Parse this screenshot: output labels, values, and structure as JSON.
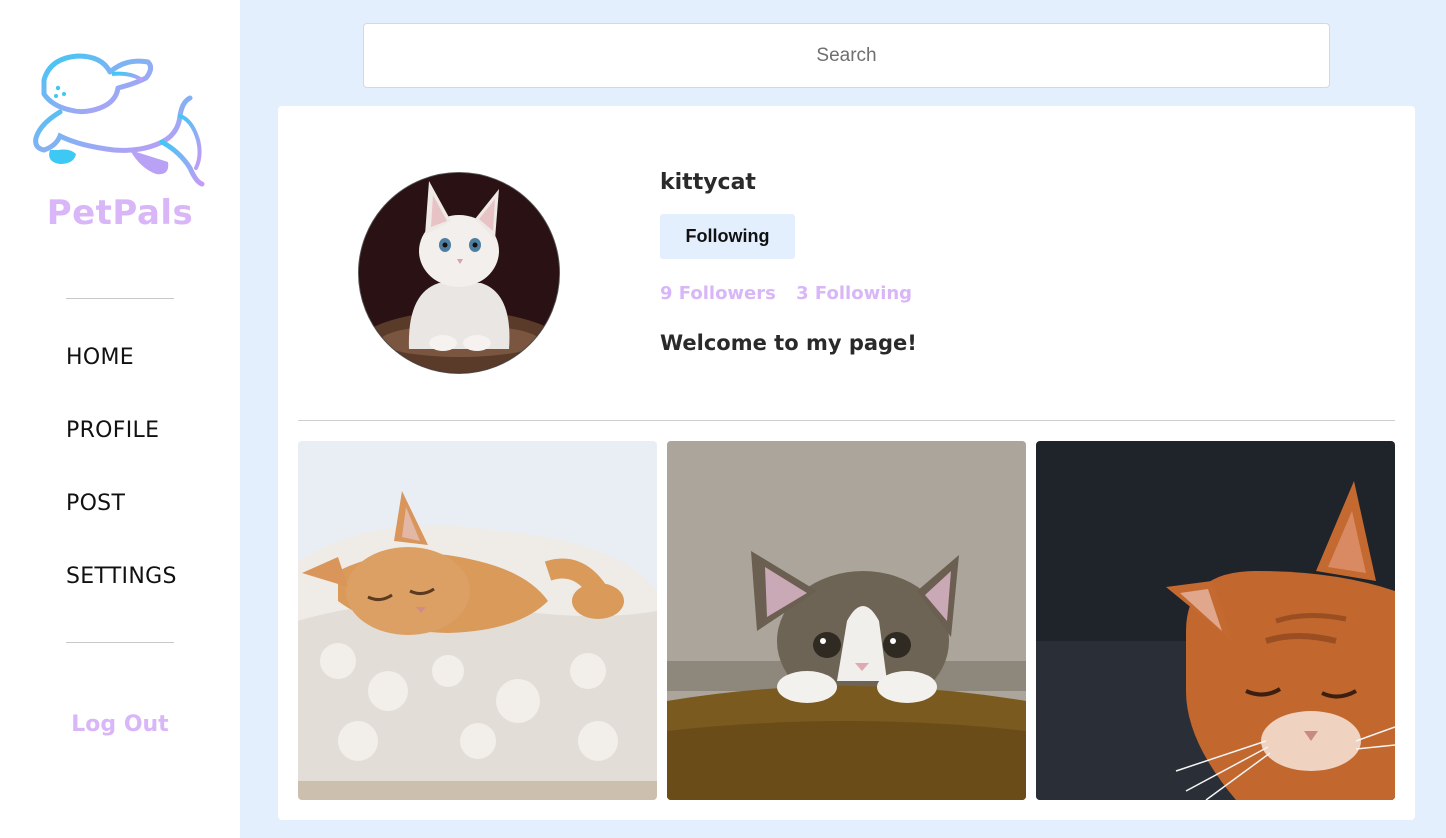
{
  "brand": {
    "name": "PetPals"
  },
  "nav": {
    "items": [
      {
        "label": "HOME"
      },
      {
        "label": "PROFILE"
      },
      {
        "label": "POST"
      },
      {
        "label": "SETTINGS"
      }
    ],
    "logout_label": "Log Out"
  },
  "search": {
    "placeholder": "Search"
  },
  "profile": {
    "username": "kittycat",
    "follow_button_label": "Following",
    "followers": "9 Followers",
    "following": "3 Following",
    "bio": "Welcome to my page!"
  },
  "colors": {
    "page_bg": "#e4effd",
    "accent_purple": "#d8b6f7",
    "logo_cyan": "#3ec8f4",
    "text_dark": "#2a2a2a"
  },
  "icons": {
    "logo": "dog-icon"
  }
}
